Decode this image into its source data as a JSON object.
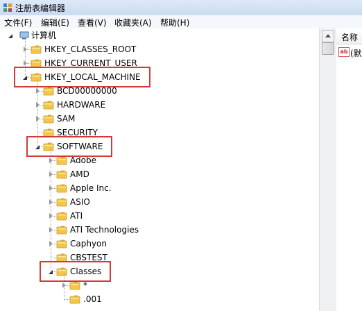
{
  "window": {
    "title": "注册表编辑器"
  },
  "menu": [
    "文件(F)",
    "编辑(E)",
    "查看(V)",
    "收藏夹(A)",
    "帮助(H)"
  ],
  "tree": {
    "root": "计算机",
    "nodes": [
      {
        "label": "HKEY_CLASSES_ROOT",
        "level": 1,
        "state": "collapsed"
      },
      {
        "label": "HKEY_CURRENT_USER",
        "level": 1,
        "state": "collapsed"
      },
      {
        "label": "HKEY_LOCAL_MACHINE",
        "level": 1,
        "state": "expanded",
        "highlighted": true
      },
      {
        "label": "BCD00000000",
        "level": 2,
        "state": "collapsed"
      },
      {
        "label": "HARDWARE",
        "level": 2,
        "state": "collapsed"
      },
      {
        "label": "SAM",
        "level": 2,
        "state": "collapsed"
      },
      {
        "label": "SECURITY",
        "level": 2,
        "state": "leaf"
      },
      {
        "label": "SOFTWARE",
        "level": 2,
        "state": "expanded",
        "highlighted": true
      },
      {
        "label": "Adobe",
        "level": 3,
        "state": "collapsed"
      },
      {
        "label": "AMD",
        "level": 3,
        "state": "collapsed"
      },
      {
        "label": "Apple Inc.",
        "level": 3,
        "state": "collapsed"
      },
      {
        "label": "ASIO",
        "level": 3,
        "state": "collapsed"
      },
      {
        "label": "ATI",
        "level": 3,
        "state": "collapsed"
      },
      {
        "label": "ATI Technologies",
        "level": 3,
        "state": "collapsed"
      },
      {
        "label": "Caphyon",
        "level": 3,
        "state": "collapsed"
      },
      {
        "label": "CBSTEST",
        "level": 3,
        "state": "leaf"
      },
      {
        "label": "Classes",
        "level": 3,
        "state": "expanded",
        "highlighted": true
      },
      {
        "label": "*",
        "level": 4,
        "state": "collapsed"
      },
      {
        "label": ".001",
        "level": 4,
        "state": "leaf"
      }
    ]
  },
  "values_pane": {
    "column_header": "名称",
    "first_value": "(默"
  },
  "colors": {
    "highlight": "#d23a3a",
    "folder": "#f2c649"
  }
}
